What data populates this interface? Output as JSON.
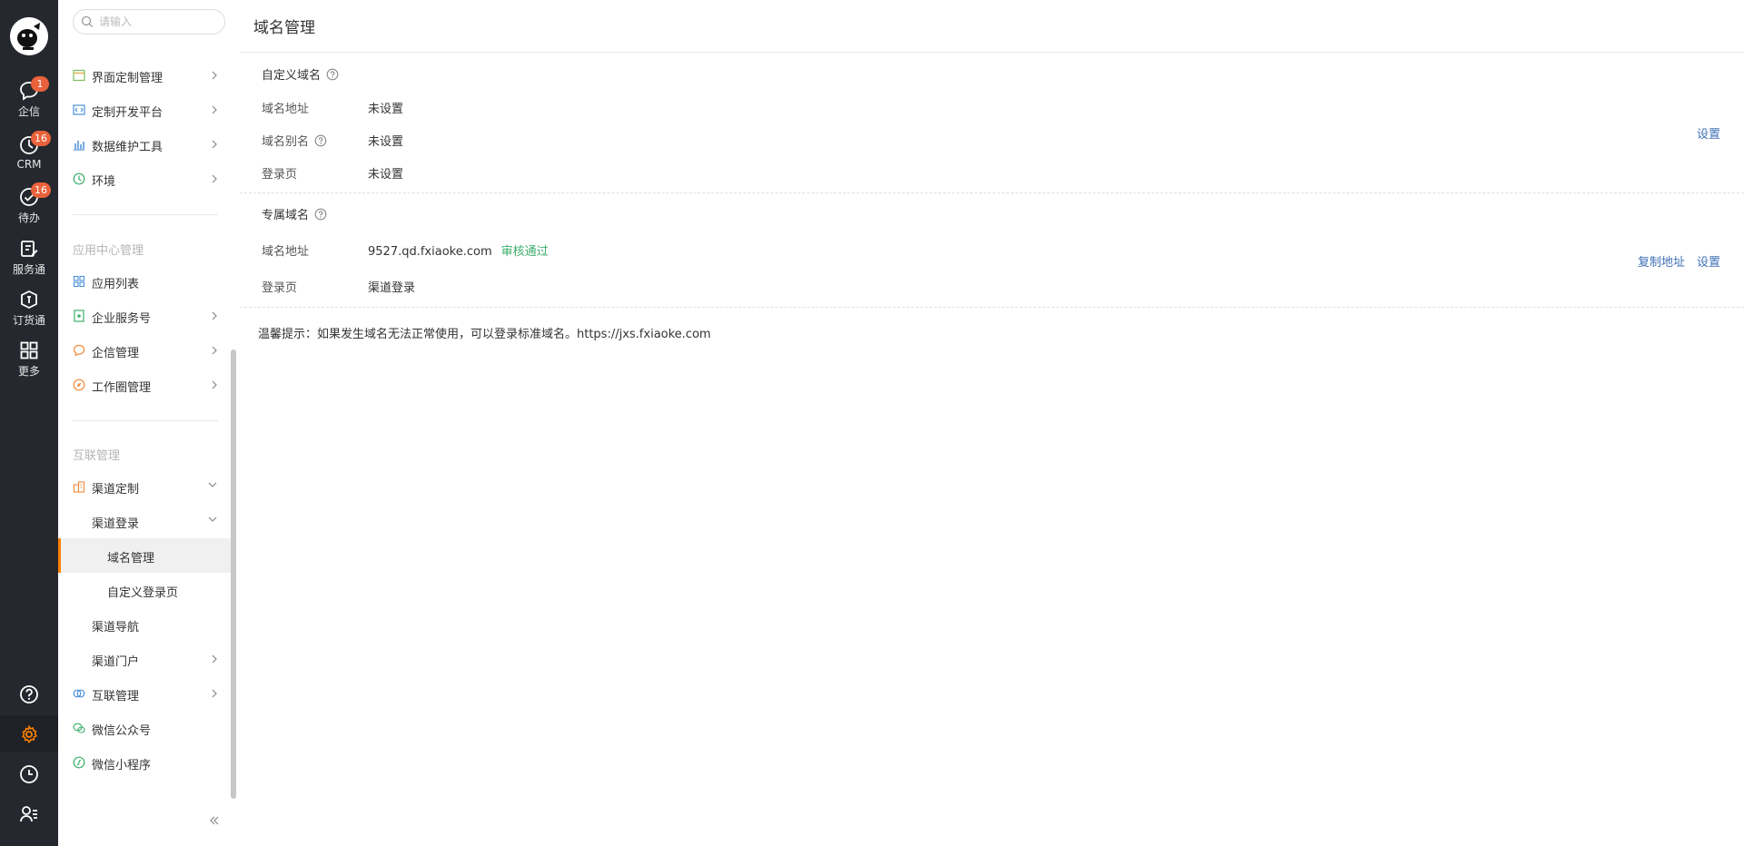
{
  "rail": {
    "items": [
      {
        "label": "企信",
        "badge": "1"
      },
      {
        "label": "CRM",
        "badge": "16"
      },
      {
        "label": "待办",
        "badge": "16"
      },
      {
        "label": "服务通"
      },
      {
        "label": "订货通"
      },
      {
        "label": "更多"
      }
    ],
    "accent": "#ff8000"
  },
  "sidebar": {
    "search_placeholder": "请输入",
    "group1": [
      {
        "label": "界面定制管理"
      },
      {
        "label": "定制开发平台"
      },
      {
        "label": "数据维护工具"
      },
      {
        "label": "环境"
      }
    ],
    "section2_title": "应用中心管理",
    "group2": [
      {
        "label": "应用列表"
      },
      {
        "label": "企业服务号"
      },
      {
        "label": "企信管理"
      },
      {
        "label": "工作圈管理"
      }
    ],
    "section3_title": "互联管理",
    "group3": [
      {
        "label": "渠道定制"
      },
      {
        "label": "渠道登录"
      },
      {
        "label": "域名管理"
      },
      {
        "label": "自定义登录页"
      },
      {
        "label": "渠道导航"
      },
      {
        "label": "渠道门户"
      },
      {
        "label": "互联管理"
      },
      {
        "label": "微信公众号"
      },
      {
        "label": "微信小程序"
      }
    ]
  },
  "main": {
    "title": "域名管理",
    "custom": {
      "heading": "自定义域名",
      "rows": [
        {
          "label": "域名地址",
          "value": "未设置"
        },
        {
          "label": "域名别名",
          "value": "未设置"
        },
        {
          "label": "登录页",
          "value": "未设置"
        }
      ],
      "action": "设置"
    },
    "exclusive": {
      "heading": "专属域名",
      "rows": [
        {
          "label": "域名地址",
          "value": "9527.qd.fxiaoke.com",
          "status": "审核通过"
        },
        {
          "label": "登录页",
          "value": "渠道登录"
        }
      ],
      "copy_action": "复制地址",
      "action": "设置"
    },
    "tip": "温馨提示：如果发生域名无法正常使用，可以登录标准域名。https://jxs.fxiaoke.com"
  }
}
